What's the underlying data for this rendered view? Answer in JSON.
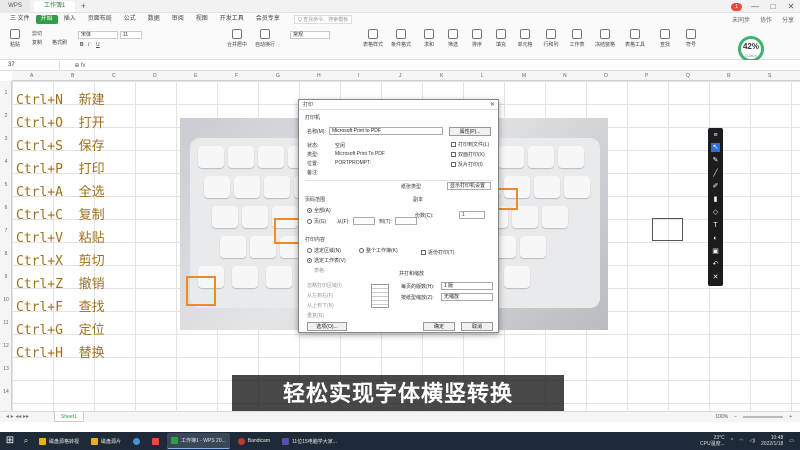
{
  "titlebar": {
    "logo": "WPS",
    "tab": "工作簿1",
    "plus": "+",
    "badge": "1",
    "win_min": "—",
    "win_max": "□",
    "win_close": "✕"
  },
  "menubar": {
    "items": [
      "三 文件",
      "开始",
      "插入",
      "页面布局",
      "公式",
      "数据",
      "审阅",
      "视图",
      "开发工具",
      "会员专享"
    ],
    "search_placeholder": "Q 查找命令、搜索模板",
    "right_items": [
      "未同步",
      "协作",
      "分享"
    ]
  },
  "ribbon": {
    "paste": "粘贴",
    "cut": "剪切",
    "copy": "复制",
    "format_painter": "格式刷",
    "font_name": "宋体",
    "font_size": "11",
    "merge_center": "合并居中",
    "auto_wrap": "自动换行",
    "number_format": "常规",
    "cond_format": "条件格式",
    "table_style": "表格样式",
    "sum": "求和",
    "filter": "筛选",
    "sort": "排序",
    "fill": "填充",
    "cell": "单元格",
    "row_col": "行和列",
    "worksheet": "工作表",
    "freeze": "冻结窗格",
    "table_tools": "表格工具",
    "find": "查找",
    "symbol": "符号"
  },
  "progress": {
    "value": "42",
    "unit": "%",
    "sub": "0.2K/s"
  },
  "formulabar": {
    "cell": "37",
    "fx": "⊕ fx"
  },
  "columns": [
    "A",
    "B",
    "C",
    "D",
    "E",
    "F",
    "G",
    "H",
    "I",
    "J",
    "K",
    "L",
    "M",
    "N",
    "O",
    "P",
    "Q",
    "R",
    "S"
  ],
  "rows": [
    "1",
    "2",
    "3",
    "4",
    "5",
    "6",
    "7",
    "8",
    "9",
    "10",
    "11",
    "12",
    "13",
    "14"
  ],
  "shortcuts": [
    "Ctrl+N  新建",
    "Ctrl+O  打开",
    "Ctrl+S  保存",
    "Ctrl+P  打印",
    "Ctrl+A  全选",
    "Ctrl+C  复制",
    "Ctrl+V  粘贴",
    "Ctrl+X  剪切",
    "Ctrl+Z  撤销",
    "Ctrl+F  查找",
    "Ctrl+G  定位",
    "Ctrl+H  替换"
  ],
  "print_dialog": {
    "title": "打印",
    "printer_group": "打印机",
    "name_label": "名称(M):",
    "printer_name": "Microsoft Print to PDF",
    "properties_btn": "属性(P)...",
    "status_label": "状态:",
    "status_value": "空闲",
    "type_label": "类型:",
    "type_value": "Microsoft Print To PDF",
    "where_label": "位置:",
    "where_value": "PORTPROMPT:",
    "comment_label": "备注:",
    "print_to_file": "打印到文件(L)",
    "duplex": "双面打印(X)",
    "manual_duplex": "反片打印(I)",
    "range_group": "页码范围",
    "all": "全部(A)",
    "pages_from": "页(G)",
    "from": "从(F):",
    "to": "到(T):",
    "print_content_group": "打印内容",
    "selection": "选定区域(N)",
    "entire_workbook": "整个工作簿(K)",
    "active_sheet": "选定工作表(V)",
    "table": "表格",
    "ignore_print_area": "忽略打印区域(I)",
    "print_order_label": "纸张类型",
    "paper_value": "显示打印机设置",
    "copies_group": "副本",
    "copies_label": "份数(C):",
    "copies_value": "1",
    "collate": "逐份打印(T)",
    "scaling_group": "并打和缩放",
    "pages_per_sheet": "每页的版数(H):",
    "pages_per_sheet_value": "1 版",
    "scale_to": "按纸型缩放(Z):",
    "scale_value": "无缩放",
    "print_order": "并打顺序",
    "order_lr": "从左到右(F)",
    "order_tb": "从上到下(B)",
    "repeat": "重复(R)",
    "options_btn": "选项(O)...",
    "ok_btn": "确定",
    "cancel_btn": "取消"
  },
  "caption": "轻松实现字体横竖转换",
  "sheetbar": {
    "tab": "Sheet1",
    "zoom": "100%",
    "zoom_minus": "−",
    "zoom_plus": "+"
  },
  "taskbar": {
    "items": [
      {
        "label": "磁盘源格转视",
        "color": "#e8b020"
      },
      {
        "label": "磁盘源片",
        "color": "#e8b020"
      },
      {
        "label": "",
        "color": "#4a90d9"
      },
      {
        "label": "",
        "color": "#e94b3c"
      },
      {
        "label": "工作簿1 - WPS 20...",
        "color": "#e94b3c"
      },
      {
        "label": "Bandicam",
        "color": "#c0392b"
      },
      {
        "label": "11位15电脑学大家...",
        "color": "#5b4bb7"
      }
    ],
    "weather": "23°C",
    "weather_sub": "CPU温度...",
    "time": "10:48",
    "date": "2022/1/18"
  }
}
